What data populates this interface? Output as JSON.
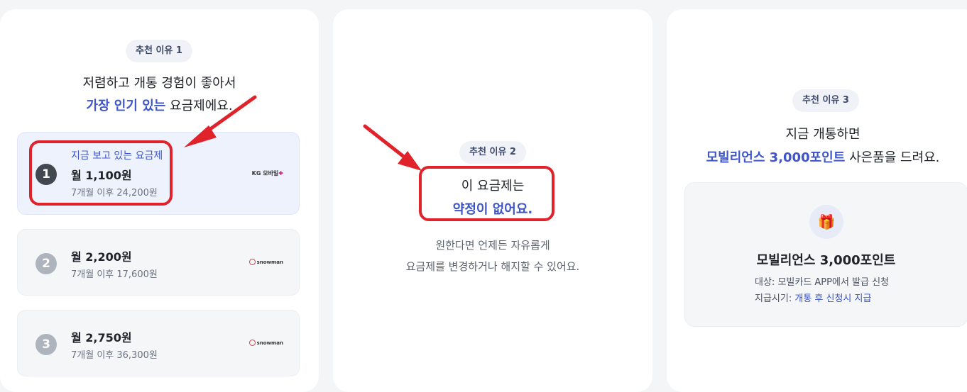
{
  "colors": {
    "accent": "#3d55c9",
    "annotation_red": "#e0222a",
    "background": "#f4f5f7"
  },
  "reason1": {
    "badge": "추천 이유 1",
    "line1": "저렴하고 개통 경험이 좋아서",
    "line2_highlight": "가장 인기 있는",
    "line2_rest": " 요금제에요.",
    "plans": [
      {
        "number": "1",
        "tag": "지금 보고 있는 요금제",
        "price": "월 1,100원",
        "after": "7개월 이후 24,200원",
        "carrier_logo": "KG 모바일",
        "carrier_icon": "kg-mobile-logo"
      },
      {
        "number": "2",
        "tag": "",
        "price": "월 2,200원",
        "after": "7개월 이후 17,600원",
        "carrier_logo": "snowman",
        "carrier_icon": "snowman-logo"
      },
      {
        "number": "3",
        "tag": "",
        "price": "월 2,750원",
        "after": "7개월 이후 36,300원",
        "carrier_logo": "snowman",
        "carrier_icon": "snowman-logo"
      }
    ]
  },
  "reason2": {
    "badge": "추천 이유 2",
    "line1": "이 요금제는",
    "line2_highlight": "약정이 없어요.",
    "desc1": "원한다면 언제든 자유롭게",
    "desc2": "요금제를 변경하거나 해지할 수 있어요."
  },
  "reason3": {
    "badge": "추천 이유 3",
    "line1": "지금 개통하면",
    "line2_highlight": "모빌리언스 3,000포인트",
    "line2_rest": " 사은품을 드려요.",
    "benefit": {
      "icon": "gift-icon",
      "title": "모빌리언스 3,000포인트",
      "target_label": "대상: ",
      "target_value": "모빌카드 APP에서 발급 신청",
      "timing_label": "지급시기: ",
      "timing_value": "개통 후 신청시 지급"
    }
  }
}
